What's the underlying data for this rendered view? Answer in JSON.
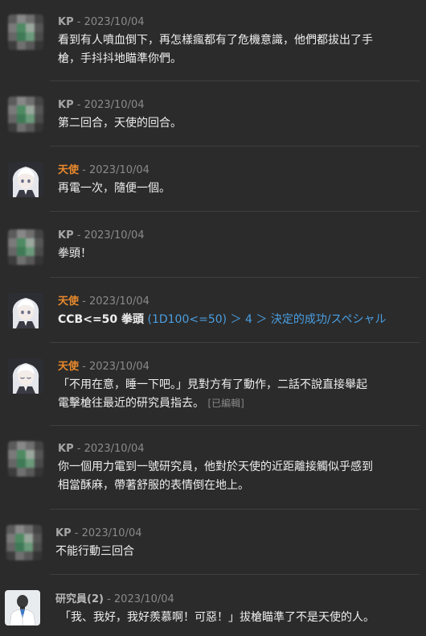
{
  "messages": [
    {
      "speaker": "KP",
      "timestamp": "- 2023/10/04",
      "avatar": "pixelated-avatar",
      "lines": [
        "看到有人噴血倒下，再怎樣瘋都有了危機意識，他們都拔出了手",
        "槍，手抖抖地瞄準你們。"
      ]
    },
    {
      "speaker": "KP",
      "timestamp": "- 2023/10/04",
      "avatar": "pixelated-avatar",
      "lines": [
        "第二回合，天使的回合。"
      ]
    },
    {
      "speaker": "天使",
      "timestamp": "- 2023/10/04",
      "avatar": "white-haired-girl-avatar",
      "lines": [
        "再電一次，隨便一個。"
      ]
    },
    {
      "speaker": "KP",
      "timestamp": "- 2023/10/04",
      "avatar": "pixelated-avatar",
      "lines": [
        "拳頭！"
      ]
    },
    {
      "speaker": "天使",
      "timestamp": "- 2023/10/04",
      "avatar": "white-haired-girl-avatar",
      "command": "CCB<=50 拳頭",
      "dice_result": "(1D100<=50) ＞ 4 ＞ 決定的成功/スペシャル"
    },
    {
      "speaker": "天使",
      "timestamp": "- 2023/10/04",
      "avatar": "white-haired-girl-closed-eyes-avatar",
      "lines": [
        "「不用在意，睡一下吧。」見對方有了動作，二話不說直接舉起",
        "電擊槍往最近的研究員指去。"
      ],
      "edited": "[已編輯]"
    },
    {
      "speaker": "KP",
      "timestamp": "- 2023/10/04",
      "avatar": "pixelated-avatar",
      "lines": [
        "你一個用力電到一號研究員，他對於天使的近距離接觸似乎感到",
        "相當酥麻，帶著舒服的表情倒在地上。"
      ]
    },
    {
      "speaker": "KP",
      "timestamp": "- 2023/10/04",
      "avatar": "pixelated-avatar",
      "lines": [
        "不能行動三回合"
      ]
    },
    {
      "speaker": "研究員(2)",
      "timestamp": "- 2023/10/04",
      "avatar": "lab-coat-man-avatar",
      "lines": [
        "「我、我好，我好羨慕啊！可惡！」拔槍瞄準了不是天使的人。"
      ]
    }
  ]
}
